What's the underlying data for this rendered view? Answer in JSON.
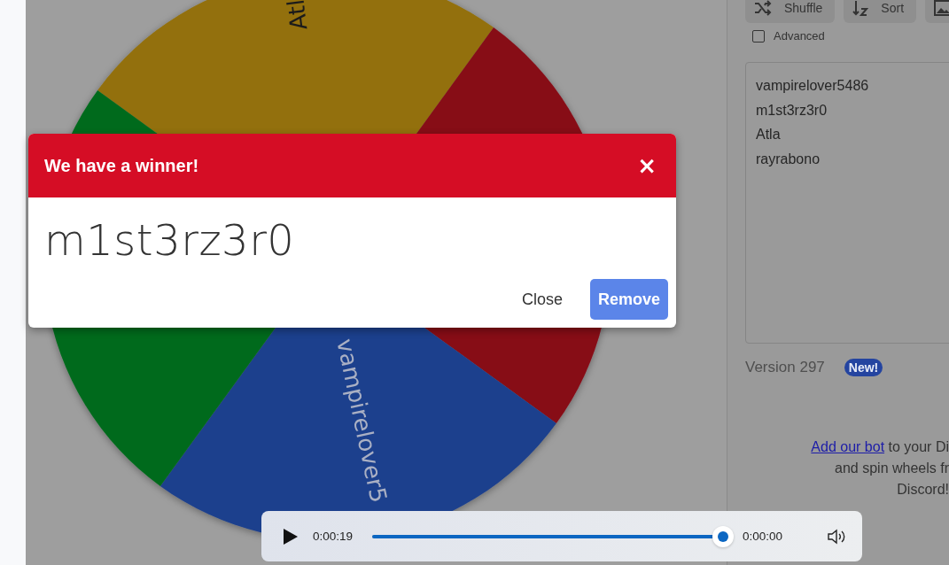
{
  "wheel": {
    "segments": [
      {
        "label": "Atl",
        "color": "#937009"
      },
      {
        "color": "#870a18"
      },
      {
        "label": "vampirelover5",
        "color": "#1f418d"
      },
      {
        "color": "#036b1e"
      }
    ]
  },
  "sidebar": {
    "buttons": [
      {
        "label": "Shuffle",
        "kind": "shuffle"
      },
      {
        "label": "Sort",
        "kind": "sort"
      },
      {
        "kind": "image"
      }
    ],
    "advanced": {
      "label": "Advanced",
      "checked": false
    },
    "entries": [
      "vampirelover5486",
      "m1st3rz3r0",
      "Atla",
      "rayrabono"
    ],
    "version": "Version 297",
    "badge": "New!",
    "promo": {
      "link": "Add our bot",
      "lines": [
        "to your Di",
        "and spin wheels fr",
        "Discord!"
      ]
    }
  },
  "dialog": {
    "title": "We have a winner!",
    "close_icon": "×",
    "winner": "m1st3rz3r0",
    "buttons": [
      {
        "label": "Close",
        "kind": "text"
      },
      {
        "label": "Remove",
        "kind": "primary"
      }
    ]
  },
  "player": {
    "elapsed": "0:00:19",
    "remaining": "0:00:00",
    "level": 1
  }
}
